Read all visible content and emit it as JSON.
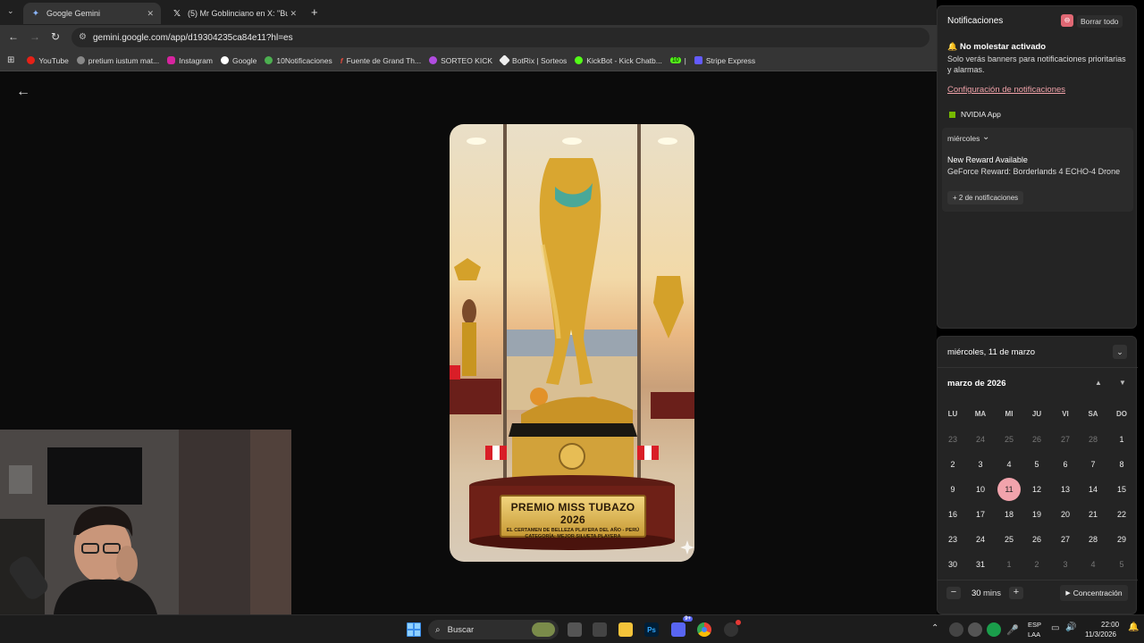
{
  "browser": {
    "tabs": [
      {
        "title": "Google Gemini",
        "active": true
      },
      {
        "title": "(5) Mr Goblinciano en X: \"Busc",
        "active": false
      }
    ],
    "new_tab": "+",
    "url": "gemini.google.com/app/d19304235ca84e11?hl=es",
    "bookmarks": [
      "YouTube",
      "pretium iustum mat...",
      "Instagram",
      "Google",
      "10Notificaciones",
      "Fuente de Grand Th...",
      "SORTEO KICK",
      "BotRix | Sorteos",
      "KickBot - Kick Chatb...",
      "|",
      "Stripe Express"
    ],
    "bookmark_badge": "10"
  },
  "image": {
    "plaque_title": "PREMIO MISS TUBAZO 2026",
    "plaque_line1": "EL CERTAMEN DE BELLEZA PLAYERA DEL AÑO - PERÚ",
    "plaque_line2": "CATEGORÍA: MEJOR SILUETA PLAYERA"
  },
  "notifications": {
    "title": "Notificaciones",
    "clear_all": "Borrar todo",
    "dnd_title": "No molestar activado",
    "dnd_text": "Solo verás banners para notificaciones prioritarias y alarmas.",
    "settings_link": "Configuración de notificaciones",
    "app_name": "NVIDIA App",
    "group_day": "miércoles",
    "item_title": "New Reward Available",
    "item_text": "GeForce Reward: Borderlands 4 ECHO-4 Drone",
    "more": "+ 2 de notificaciones"
  },
  "calendar": {
    "date_header": "miércoles, 11 de marzo",
    "month": "marzo de 2026",
    "weekdays": [
      "LU",
      "MA",
      "MI",
      "JU",
      "VI",
      "SA",
      "DO"
    ],
    "weeks": [
      [
        "23",
        "24",
        "25",
        "26",
        "27",
        "28",
        "1"
      ],
      [
        "2",
        "3",
        "4",
        "5",
        "6",
        "7",
        "8"
      ],
      [
        "9",
        "10",
        "11",
        "12",
        "13",
        "14",
        "15"
      ],
      [
        "16",
        "17",
        "18",
        "19",
        "20",
        "21",
        "22"
      ],
      [
        "23",
        "24",
        "25",
        "26",
        "27",
        "28",
        "29"
      ],
      [
        "30",
        "31",
        "1",
        "2",
        "3",
        "4",
        "5"
      ]
    ],
    "today": "11",
    "focus_minutes": "30",
    "focus_unit": "mins",
    "focus_button": "Concentración"
  },
  "taskbar": {
    "search": "Buscar",
    "lang_top": "ESP",
    "lang_bottom": "LAA",
    "time": "22:00",
    "date": "11/3/2026",
    "discord_badge": "9+"
  },
  "colors": {
    "today_highlight": "#f1a3ac",
    "link": "#f0a2a9",
    "windows_blue": "#3b8eea"
  }
}
